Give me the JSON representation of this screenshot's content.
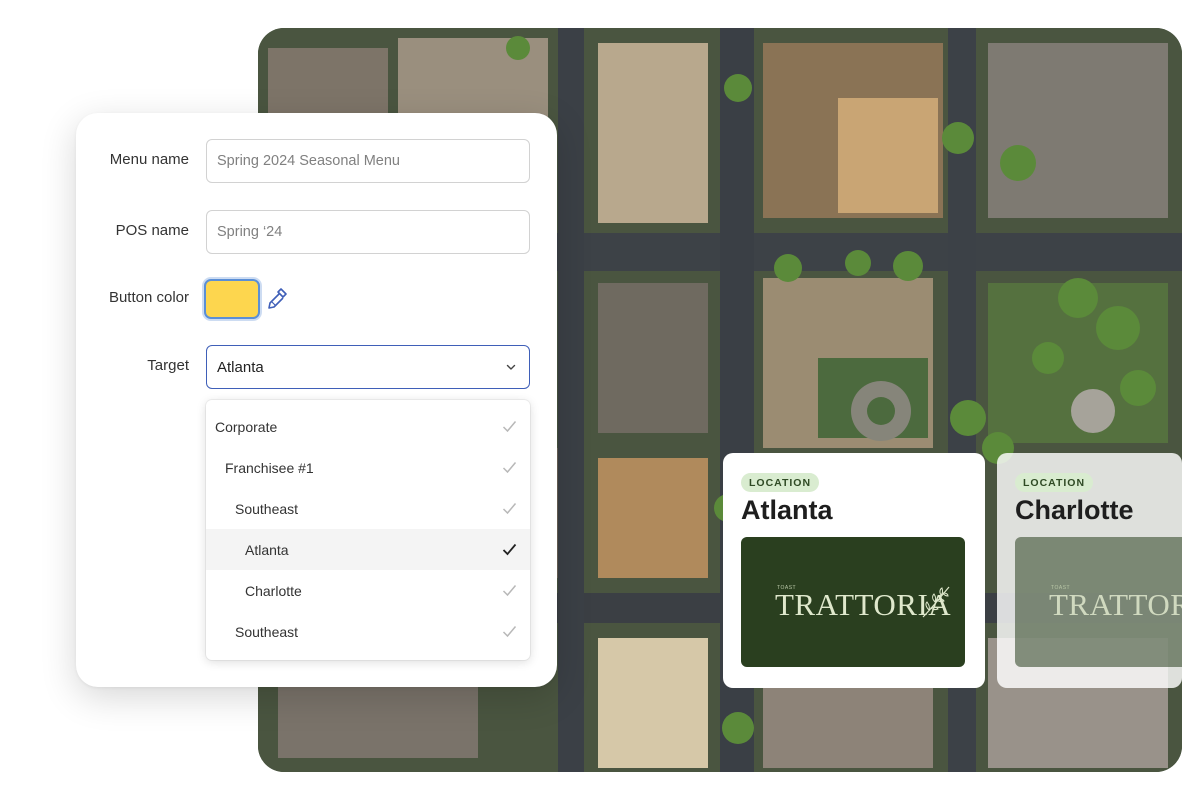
{
  "form": {
    "menu_name": {
      "label": "Menu name",
      "value": "Spring 2024 Seasonal Menu"
    },
    "pos_name": {
      "label": "POS name",
      "value": "Spring ‘24"
    },
    "button_color": {
      "label": "Button color",
      "color": "#FDD64E",
      "icon": "eyedropper-icon"
    },
    "target": {
      "label": "Target",
      "value": "Atlanta",
      "options": [
        {
          "label": "Corporate",
          "level": 0,
          "selected": false
        },
        {
          "label": "Franchisee #1",
          "level": 1,
          "selected": false
        },
        {
          "label": "Southeast",
          "level": 2,
          "selected": false
        },
        {
          "label": "Atlanta",
          "level": 3,
          "selected": true
        },
        {
          "label": "Charlotte",
          "level": 3,
          "selected": false
        },
        {
          "label": "Southeast",
          "level": 2,
          "selected": false
        }
      ]
    }
  },
  "locations": [
    {
      "badge": "LOCATION",
      "name": "Atlanta",
      "logo_small": "TOAST",
      "logo_text": "TRATTORIA"
    },
    {
      "badge": "LOCATION",
      "name": "Charlotte",
      "logo_small": "TOAST",
      "logo_text": "TRATTORIA"
    }
  ],
  "colors": {
    "accent_blue": "#3F5FB8",
    "badge_green": "#D9ECD0",
    "logo_bg": "#2A3F1F"
  }
}
